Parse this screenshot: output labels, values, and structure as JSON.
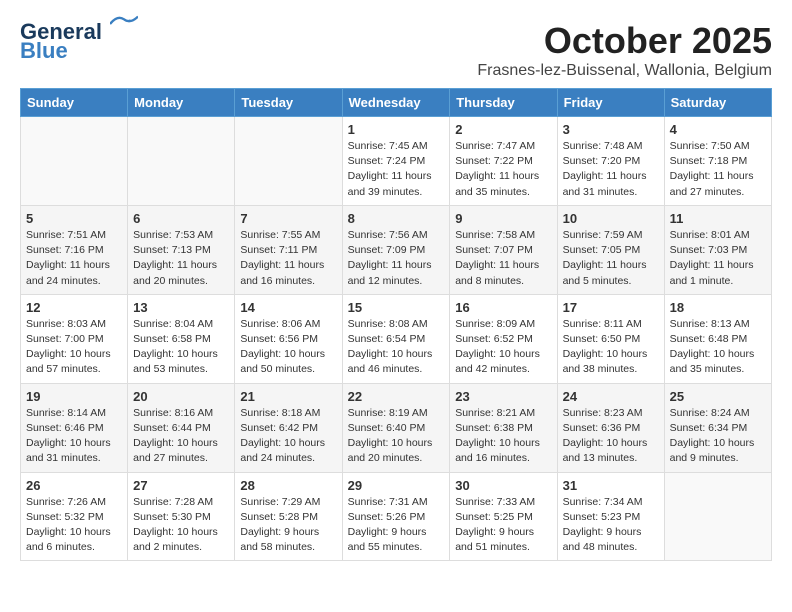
{
  "header": {
    "logo_line1": "General",
    "logo_line2": "Blue",
    "month": "October 2025",
    "location": "Frasnes-lez-Buissenal, Wallonia, Belgium"
  },
  "weekdays": [
    "Sunday",
    "Monday",
    "Tuesday",
    "Wednesday",
    "Thursday",
    "Friday",
    "Saturday"
  ],
  "weeks": [
    [
      {
        "day": "",
        "info": ""
      },
      {
        "day": "",
        "info": ""
      },
      {
        "day": "",
        "info": ""
      },
      {
        "day": "1",
        "info": "Sunrise: 7:45 AM\nSunset: 7:24 PM\nDaylight: 11 hours\nand 39 minutes."
      },
      {
        "day": "2",
        "info": "Sunrise: 7:47 AM\nSunset: 7:22 PM\nDaylight: 11 hours\nand 35 minutes."
      },
      {
        "day": "3",
        "info": "Sunrise: 7:48 AM\nSunset: 7:20 PM\nDaylight: 11 hours\nand 31 minutes."
      },
      {
        "day": "4",
        "info": "Sunrise: 7:50 AM\nSunset: 7:18 PM\nDaylight: 11 hours\nand 27 minutes."
      }
    ],
    [
      {
        "day": "5",
        "info": "Sunrise: 7:51 AM\nSunset: 7:16 PM\nDaylight: 11 hours\nand 24 minutes."
      },
      {
        "day": "6",
        "info": "Sunrise: 7:53 AM\nSunset: 7:13 PM\nDaylight: 11 hours\nand 20 minutes."
      },
      {
        "day": "7",
        "info": "Sunrise: 7:55 AM\nSunset: 7:11 PM\nDaylight: 11 hours\nand 16 minutes."
      },
      {
        "day": "8",
        "info": "Sunrise: 7:56 AM\nSunset: 7:09 PM\nDaylight: 11 hours\nand 12 minutes."
      },
      {
        "day": "9",
        "info": "Sunrise: 7:58 AM\nSunset: 7:07 PM\nDaylight: 11 hours\nand 8 minutes."
      },
      {
        "day": "10",
        "info": "Sunrise: 7:59 AM\nSunset: 7:05 PM\nDaylight: 11 hours\nand 5 minutes."
      },
      {
        "day": "11",
        "info": "Sunrise: 8:01 AM\nSunset: 7:03 PM\nDaylight: 11 hours\nand 1 minute."
      }
    ],
    [
      {
        "day": "12",
        "info": "Sunrise: 8:03 AM\nSunset: 7:00 PM\nDaylight: 10 hours\nand 57 minutes."
      },
      {
        "day": "13",
        "info": "Sunrise: 8:04 AM\nSunset: 6:58 PM\nDaylight: 10 hours\nand 53 minutes."
      },
      {
        "day": "14",
        "info": "Sunrise: 8:06 AM\nSunset: 6:56 PM\nDaylight: 10 hours\nand 50 minutes."
      },
      {
        "day": "15",
        "info": "Sunrise: 8:08 AM\nSunset: 6:54 PM\nDaylight: 10 hours\nand 46 minutes."
      },
      {
        "day": "16",
        "info": "Sunrise: 8:09 AM\nSunset: 6:52 PM\nDaylight: 10 hours\nand 42 minutes."
      },
      {
        "day": "17",
        "info": "Sunrise: 8:11 AM\nSunset: 6:50 PM\nDaylight: 10 hours\nand 38 minutes."
      },
      {
        "day": "18",
        "info": "Sunrise: 8:13 AM\nSunset: 6:48 PM\nDaylight: 10 hours\nand 35 minutes."
      }
    ],
    [
      {
        "day": "19",
        "info": "Sunrise: 8:14 AM\nSunset: 6:46 PM\nDaylight: 10 hours\nand 31 minutes."
      },
      {
        "day": "20",
        "info": "Sunrise: 8:16 AM\nSunset: 6:44 PM\nDaylight: 10 hours\nand 27 minutes."
      },
      {
        "day": "21",
        "info": "Sunrise: 8:18 AM\nSunset: 6:42 PM\nDaylight: 10 hours\nand 24 minutes."
      },
      {
        "day": "22",
        "info": "Sunrise: 8:19 AM\nSunset: 6:40 PM\nDaylight: 10 hours\nand 20 minutes."
      },
      {
        "day": "23",
        "info": "Sunrise: 8:21 AM\nSunset: 6:38 PM\nDaylight: 10 hours\nand 16 minutes."
      },
      {
        "day": "24",
        "info": "Sunrise: 8:23 AM\nSunset: 6:36 PM\nDaylight: 10 hours\nand 13 minutes."
      },
      {
        "day": "25",
        "info": "Sunrise: 8:24 AM\nSunset: 6:34 PM\nDaylight: 10 hours\nand 9 minutes."
      }
    ],
    [
      {
        "day": "26",
        "info": "Sunrise: 7:26 AM\nSunset: 5:32 PM\nDaylight: 10 hours\nand 6 minutes."
      },
      {
        "day": "27",
        "info": "Sunrise: 7:28 AM\nSunset: 5:30 PM\nDaylight: 10 hours\nand 2 minutes."
      },
      {
        "day": "28",
        "info": "Sunrise: 7:29 AM\nSunset: 5:28 PM\nDaylight: 9 hours\nand 58 minutes."
      },
      {
        "day": "29",
        "info": "Sunrise: 7:31 AM\nSunset: 5:26 PM\nDaylight: 9 hours\nand 55 minutes."
      },
      {
        "day": "30",
        "info": "Sunrise: 7:33 AM\nSunset: 5:25 PM\nDaylight: 9 hours\nand 51 minutes."
      },
      {
        "day": "31",
        "info": "Sunrise: 7:34 AM\nSunset: 5:23 PM\nDaylight: 9 hours\nand 48 minutes."
      },
      {
        "day": "",
        "info": ""
      }
    ]
  ]
}
